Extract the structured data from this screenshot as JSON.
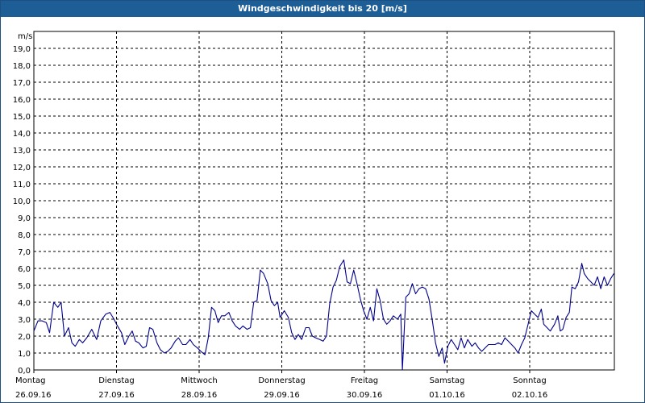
{
  "window": {
    "title": "Windgeschwindigkeit bis 20 [m/s]"
  },
  "colors": {
    "title_bar": "#1e5e96",
    "line": "#00008b",
    "grid": "#000000"
  },
  "chart_data": {
    "type": "line",
    "title": "Windgeschwindigkeit bis 20 [m/s]",
    "ylabel": "m/s",
    "ylim": [
      0,
      20
    ],
    "y_ticks": [
      "0,0",
      "1,0",
      "2,0",
      "3,0",
      "4,0",
      "5,0",
      "6,0",
      "7,0",
      "8,0",
      "9,0",
      "10,0",
      "11,0",
      "12,0",
      "13,0",
      "14,0",
      "15,0",
      "16,0",
      "17,0",
      "18,0",
      "19,0"
    ],
    "grid": true,
    "x_categories": [
      {
        "day": "Montag",
        "date": "26.09.16"
      },
      {
        "day": "Dienstag",
        "date": "27.09.16"
      },
      {
        "day": "Mittwoch",
        "date": "28.09.16"
      },
      {
        "day": "Donnerstag",
        "date": "29.09.16"
      },
      {
        "day": "Freitag",
        "date": "30.09.16"
      },
      {
        "day": "Samstag",
        "date": "01.10.16"
      },
      {
        "day": "Sonntag",
        "date": "02.10.16"
      }
    ],
    "series": [
      {
        "values": [
          [
            0.0,
            2.3
          ],
          [
            0.05,
            2.9
          ],
          [
            0.1,
            2.9
          ],
          [
            0.15,
            2.8
          ],
          [
            0.19,
            2.2
          ],
          [
            0.24,
            4.0
          ],
          [
            0.29,
            3.7
          ],
          [
            0.33,
            4.0
          ],
          [
            0.37,
            2.0
          ],
          [
            0.42,
            2.5
          ],
          [
            0.46,
            1.6
          ],
          [
            0.5,
            1.4
          ],
          [
            0.55,
            1.8
          ],
          [
            0.59,
            1.6
          ],
          [
            0.64,
            1.9
          ],
          [
            0.7,
            2.4
          ],
          [
            0.76,
            1.8
          ],
          [
            0.81,
            2.9
          ],
          [
            0.87,
            3.3
          ],
          [
            0.92,
            3.4
          ],
          [
            0.97,
            3.0
          ],
          [
            1.0,
            2.7
          ],
          [
            1.06,
            2.2
          ],
          [
            1.1,
            1.5
          ],
          [
            1.15,
            2.0
          ],
          [
            1.19,
            2.3
          ],
          [
            1.23,
            1.7
          ],
          [
            1.27,
            1.6
          ],
          [
            1.32,
            1.3
          ],
          [
            1.36,
            1.4
          ],
          [
            1.4,
            2.5
          ],
          [
            1.44,
            2.4
          ],
          [
            1.49,
            1.6
          ],
          [
            1.53,
            1.2
          ],
          [
            1.58,
            1.0
          ],
          [
            1.62,
            1.1
          ],
          [
            1.66,
            1.3
          ],
          [
            1.71,
            1.7
          ],
          [
            1.75,
            1.9
          ],
          [
            1.8,
            1.5
          ],
          [
            1.84,
            1.5
          ],
          [
            1.89,
            1.8
          ],
          [
            1.93,
            1.5
          ],
          [
            1.98,
            1.3
          ],
          [
            2.02,
            1.1
          ],
          [
            2.07,
            0.9
          ],
          [
            2.11,
            1.9
          ],
          [
            2.15,
            3.7
          ],
          [
            2.19,
            3.5
          ],
          [
            2.23,
            2.8
          ],
          [
            2.27,
            3.2
          ],
          [
            2.31,
            3.2
          ],
          [
            2.36,
            3.4
          ],
          [
            2.4,
            2.9
          ],
          [
            2.44,
            2.6
          ],
          [
            2.49,
            2.4
          ],
          [
            2.53,
            2.6
          ],
          [
            2.58,
            2.4
          ],
          [
            2.62,
            2.5
          ],
          [
            2.66,
            4.0
          ],
          [
            2.7,
            4.1
          ],
          [
            2.74,
            5.9
          ],
          [
            2.78,
            5.7
          ],
          [
            2.83,
            5.1
          ],
          [
            2.87,
            4.1
          ],
          [
            2.91,
            3.8
          ],
          [
            2.95,
            4.0
          ],
          [
            2.98,
            3.1
          ],
          [
            3.03,
            3.5
          ],
          [
            3.08,
            3.1
          ],
          [
            3.12,
            2.2
          ],
          [
            3.16,
            1.8
          ],
          [
            3.2,
            2.1
          ],
          [
            3.24,
            1.8
          ],
          [
            3.29,
            2.5
          ],
          [
            3.33,
            2.5
          ],
          [
            3.37,
            2.0
          ],
          [
            3.41,
            1.9
          ],
          [
            3.46,
            1.8
          ],
          [
            3.5,
            1.7
          ],
          [
            3.54,
            2.0
          ],
          [
            3.58,
            3.9
          ],
          [
            3.62,
            4.9
          ],
          [
            3.66,
            5.3
          ],
          [
            3.7,
            6.1
          ],
          [
            3.75,
            6.5
          ],
          [
            3.79,
            5.2
          ],
          [
            3.83,
            5.1
          ],
          [
            3.87,
            5.9
          ],
          [
            3.91,
            5.1
          ],
          [
            3.95,
            4.2
          ],
          [
            3.99,
            3.5
          ],
          [
            4.03,
            3.0
          ],
          [
            4.07,
            3.7
          ],
          [
            4.11,
            2.9
          ],
          [
            4.15,
            4.8
          ],
          [
            4.19,
            4.1
          ],
          [
            4.23,
            3.0
          ],
          [
            4.27,
            2.7
          ],
          [
            4.31,
            2.9
          ],
          [
            4.35,
            3.2
          ],
          [
            4.4,
            3.0
          ],
          [
            4.44,
            3.3
          ],
          [
            4.46,
            0.0
          ],
          [
            4.5,
            4.3
          ],
          [
            4.54,
            4.5
          ],
          [
            4.58,
            5.1
          ],
          [
            4.62,
            4.5
          ],
          [
            4.66,
            4.8
          ],
          [
            4.7,
            4.9
          ],
          [
            4.74,
            4.8
          ],
          [
            4.78,
            4.2
          ],
          [
            4.82,
            3.0
          ],
          [
            4.86,
            1.6
          ],
          [
            4.9,
            0.8
          ],
          [
            4.94,
            1.3
          ],
          [
            4.97,
            0.4
          ],
          [
            5.01,
            1.4
          ],
          [
            5.05,
            1.8
          ],
          [
            5.09,
            1.5
          ],
          [
            5.13,
            1.2
          ],
          [
            5.17,
            1.9
          ],
          [
            5.21,
            1.3
          ],
          [
            5.25,
            1.8
          ],
          [
            5.3,
            1.4
          ],
          [
            5.34,
            1.6
          ],
          [
            5.38,
            1.3
          ],
          [
            5.42,
            1.1
          ],
          [
            5.46,
            1.3
          ],
          [
            5.5,
            1.5
          ],
          [
            5.54,
            1.5
          ],
          [
            5.58,
            1.5
          ],
          [
            5.62,
            1.6
          ],
          [
            5.66,
            1.5
          ],
          [
            5.7,
            1.9
          ],
          [
            5.74,
            1.7
          ],
          [
            5.78,
            1.5
          ],
          [
            5.82,
            1.3
          ],
          [
            5.86,
            1.0
          ],
          [
            5.9,
            1.5
          ],
          [
            5.94,
            1.9
          ],
          [
            5.98,
            2.7
          ],
          [
            6.02,
            3.5
          ],
          [
            6.06,
            3.3
          ],
          [
            6.1,
            3.1
          ],
          [
            6.14,
            3.6
          ],
          [
            6.17,
            2.7
          ],
          [
            6.21,
            2.5
          ],
          [
            6.25,
            2.3
          ],
          [
            6.3,
            2.7
          ],
          [
            6.34,
            3.2
          ],
          [
            6.37,
            2.3
          ],
          [
            6.4,
            2.4
          ],
          [
            6.44,
            3.1
          ],
          [
            6.48,
            3.4
          ],
          [
            6.51,
            4.9
          ],
          [
            6.55,
            4.8
          ],
          [
            6.59,
            5.2
          ],
          [
            6.63,
            6.3
          ],
          [
            6.66,
            5.7
          ],
          [
            6.7,
            5.4
          ],
          [
            6.74,
            5.2
          ],
          [
            6.78,
            5.0
          ],
          [
            6.82,
            5.5
          ],
          [
            6.86,
            4.8
          ],
          [
            6.9,
            5.5
          ],
          [
            6.94,
            5.0
          ],
          [
            6.98,
            5.4
          ],
          [
            7.02,
            5.7
          ]
        ]
      }
    ]
  }
}
